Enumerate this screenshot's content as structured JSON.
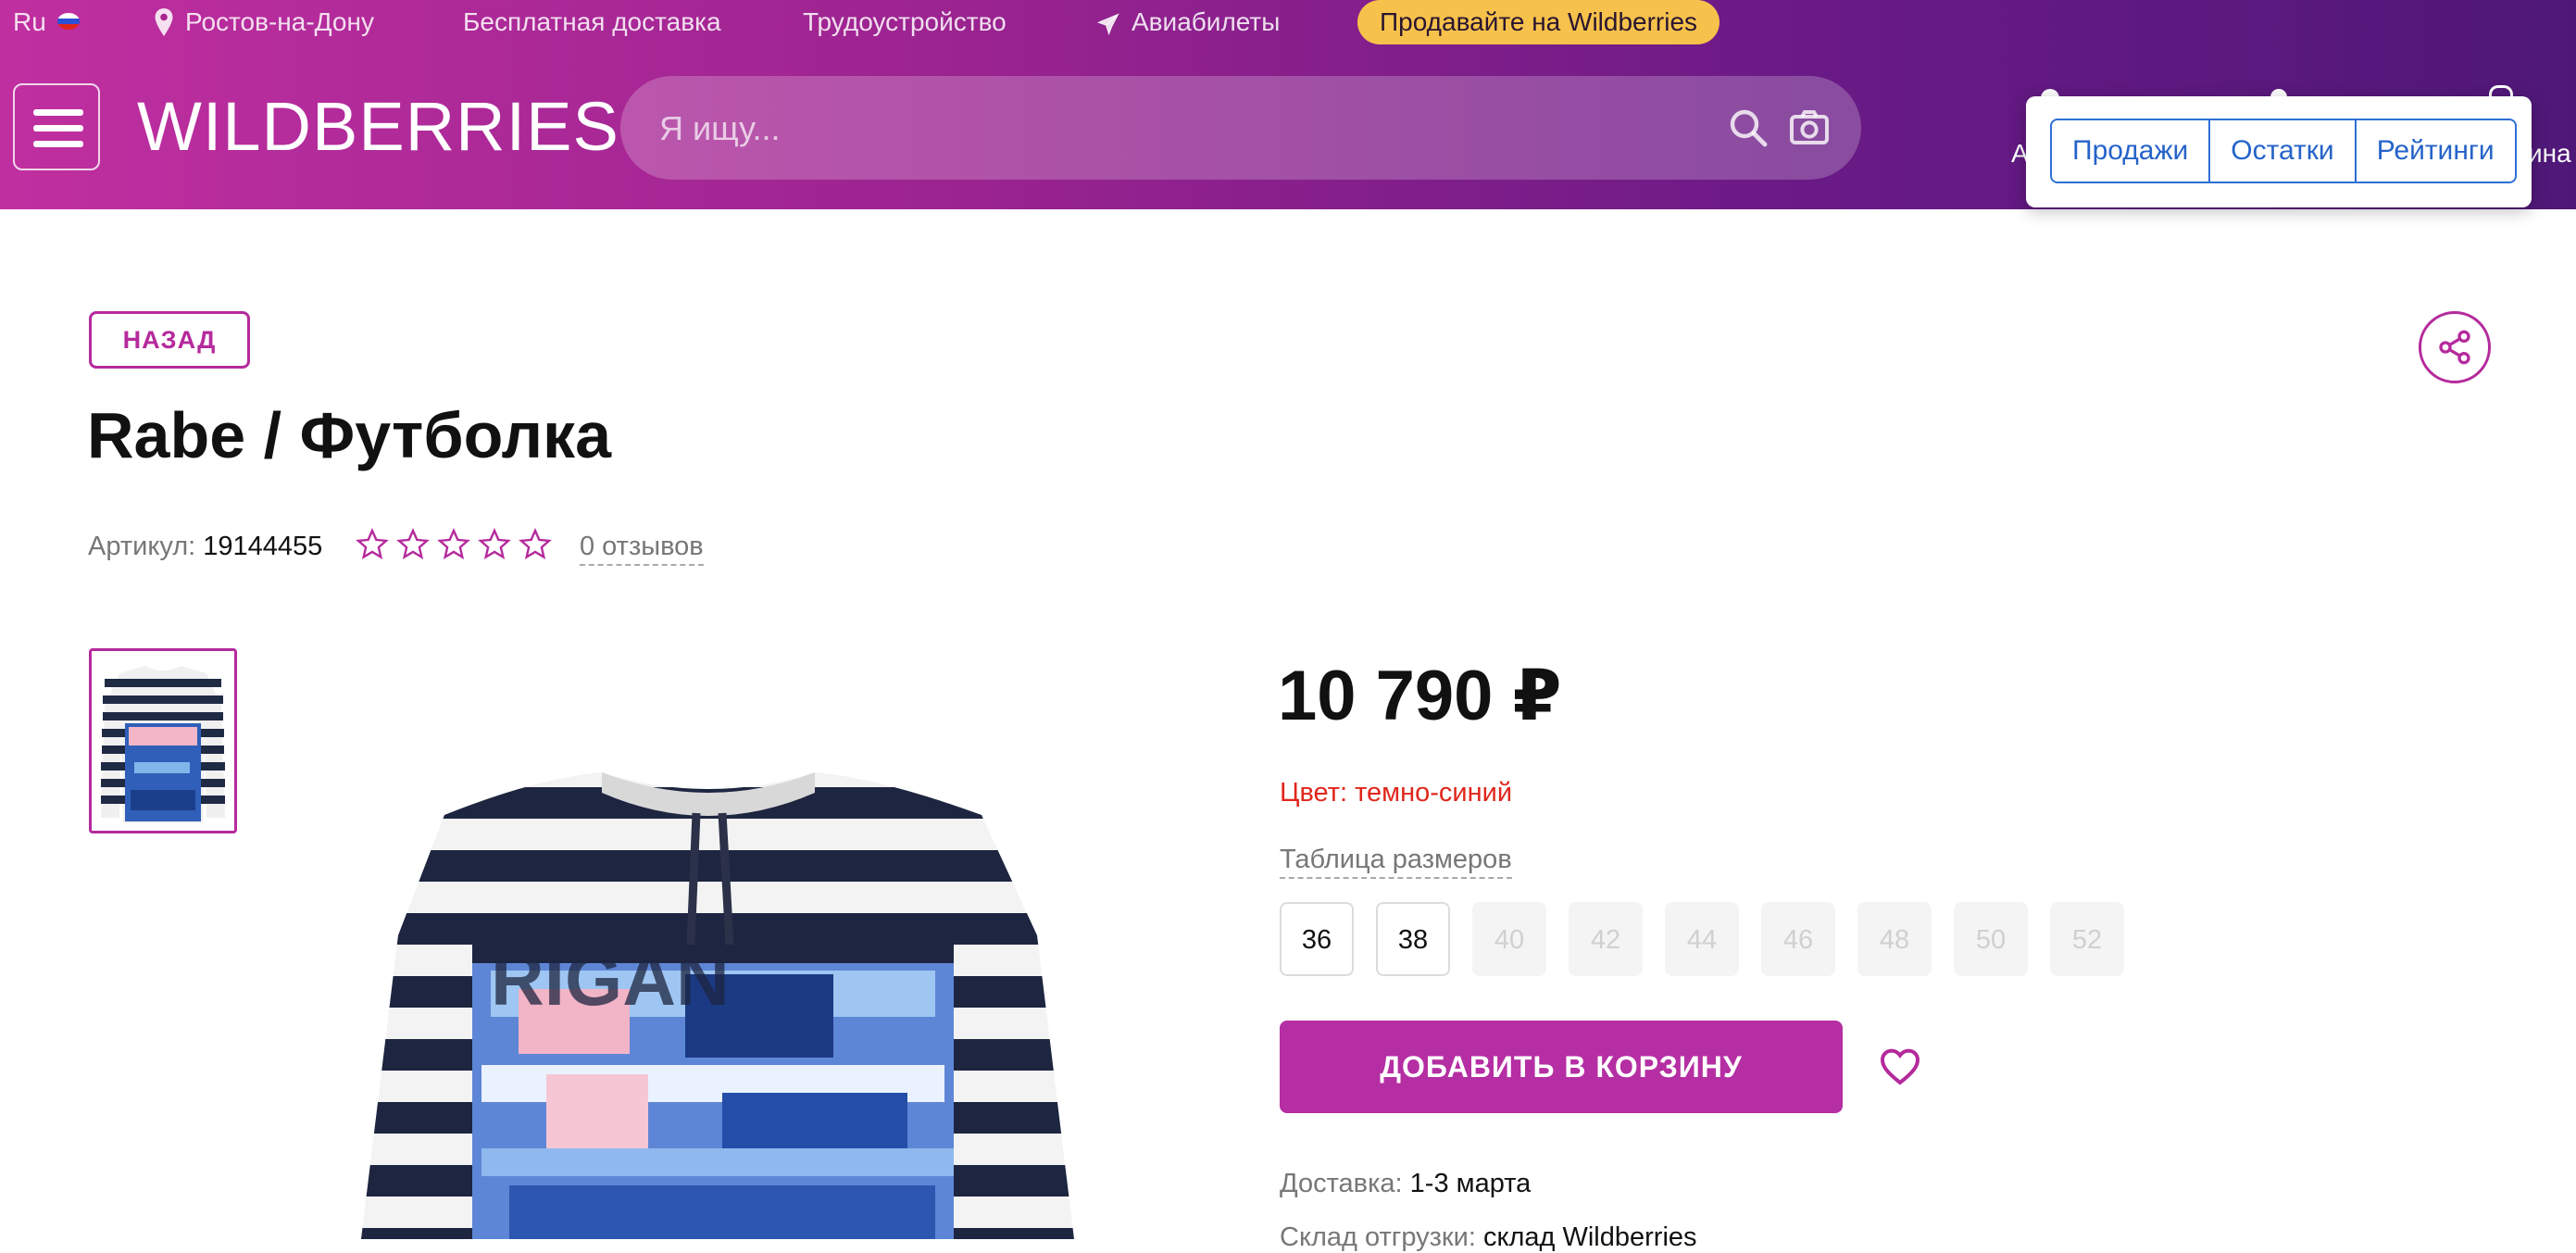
{
  "topbar": {
    "lang": "Ru",
    "city": "Ростов-на-Дону",
    "free_delivery": "Бесплатная доставка",
    "jobs": "Трудоустройство",
    "flights": "Авиабилеты",
    "sell": "Продавайте на Wildberries"
  },
  "header": {
    "logo": "WILDBERRIES",
    "search_placeholder": "Я ищу...",
    "edge_left": "А",
    "edge_right": "ина"
  },
  "popup": {
    "buttons": [
      "Продажи",
      "Остатки",
      "Рейтинги"
    ]
  },
  "product": {
    "back": "НАЗАД",
    "title": "Rabe / Футболка",
    "article_label": "Артикул:",
    "article": "19144455",
    "rating_stars": 0,
    "reviews": "0 отзывов",
    "price": "10 790 ₽",
    "color": "Цвет: темно-синий",
    "size_table": "Таблица размеров",
    "sizes": [
      {
        "label": "36",
        "available": true
      },
      {
        "label": "38",
        "available": true
      },
      {
        "label": "40",
        "available": false
      },
      {
        "label": "42",
        "available": false
      },
      {
        "label": "44",
        "available": false
      },
      {
        "label": "46",
        "available": false
      },
      {
        "label": "48",
        "available": false
      },
      {
        "label": "50",
        "available": false
      },
      {
        "label": "52",
        "available": false
      }
    ],
    "add_to_cart": "ДОБАВИТЬ В КОРЗИНУ",
    "delivery_label": "Доставка:",
    "delivery_value": "1-3 марта",
    "seller_label": "Склад отгрузки:",
    "seller_value": "склад Wildberries"
  },
  "colors": {
    "accent": "#b52ea3",
    "header_start": "#c02fa0",
    "header_end": "#4f1878",
    "sell_button": "#f6c24b",
    "color_text": "#e0261c",
    "popup_blue": "#2563c9"
  },
  "icons": {
    "location": "map-pin-icon",
    "plane": "plane-icon",
    "search": "search-icon",
    "camera": "camera-icon",
    "share": "share-icon",
    "heart": "heart-icon",
    "menu": "menu-icon"
  }
}
